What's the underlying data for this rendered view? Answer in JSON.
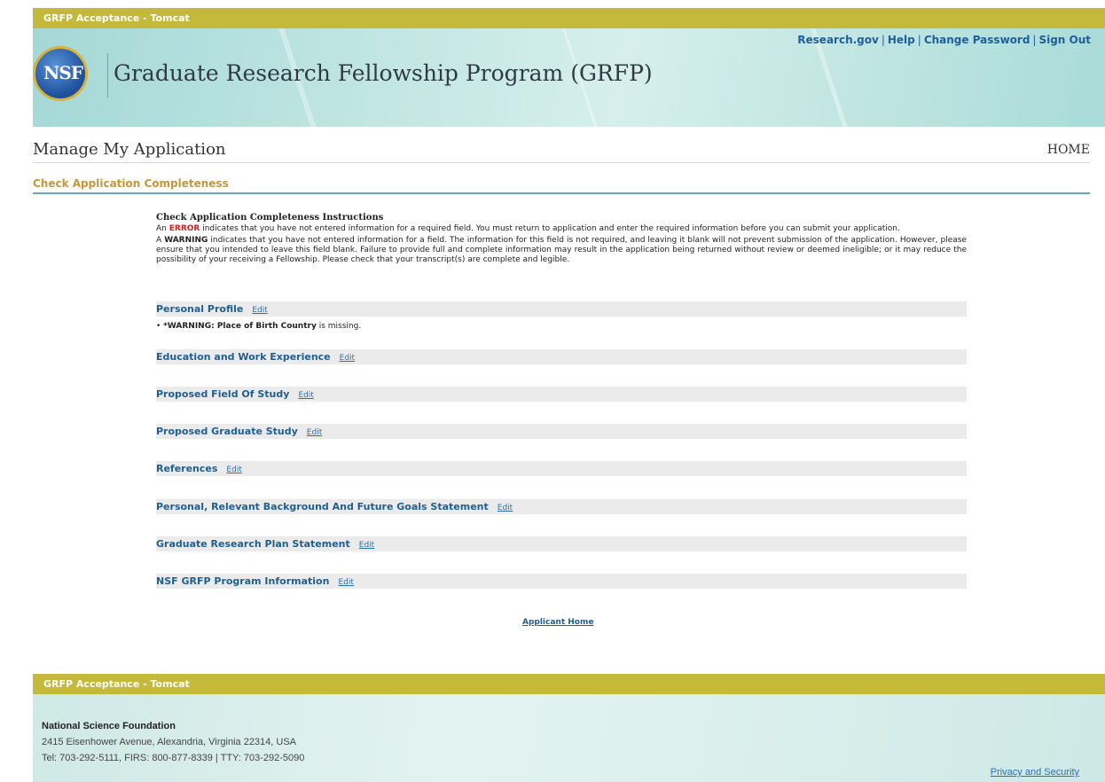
{
  "env_label": "GRFP Acceptance - Tomcat",
  "header": {
    "logo_text": "NSF",
    "title": "Graduate Research Fellowship Program (GRFP)",
    "links": [
      "Research.gov",
      "Help",
      "Change Password",
      "Sign Out"
    ]
  },
  "page": {
    "title": "Manage My Application",
    "home_link": "HOME",
    "section_title": "Check Application Completeness"
  },
  "instructions": {
    "title": "Check Application Completeness Instructions",
    "error_prefix": "An",
    "error_word": "ERROR",
    "error_text": "indicates that you have not entered information for a required field. You must return to application and enter the required information before you can submit your application.",
    "warning_prefix": "A",
    "warning_word": "WARNING",
    "warning_text": "indicates that you have not entered information for a field. The information for this field is not required, and leaving it blank will not prevent submission of the application. However, please ensure that you intended to leave this field blank. Failure to provide full and complete information may result in the application being returned without review or deemed ineligible; or it may reduce the possibility of your receiving a Fellowship. Please check that your transcript(s) are complete and legible."
  },
  "edit_label": "Edit",
  "sections": [
    {
      "label": "Personal Profile"
    },
    {
      "label": "Education and Work Experience"
    },
    {
      "label": "Proposed Field Of Study"
    },
    {
      "label": "Proposed Graduate Study"
    },
    {
      "label": "References"
    },
    {
      "label": "Personal, Relevant Background And Future Goals Statement"
    },
    {
      "label": "Graduate Research Plan Statement"
    },
    {
      "label": "NSF GRFP Program Information"
    }
  ],
  "missing_item": {
    "bold": "*WARNING: Place of Birth Country",
    "rest": "is missing."
  },
  "applicant_home": "Applicant Home",
  "footer": {
    "org": "National Science Foundation",
    "address": "2415 Eisenhower Avenue, Alexandria, Virginia 22314, USA",
    "tel": "Tel: 703-292-5111, FIRS: 800-877-8339 | TTY: 703-292-5090",
    "privacy": "Privacy and Security"
  },
  "colors": {
    "env_bar": "#c4b93a",
    "link": "#1f5f99",
    "section_title": "#c6973a",
    "error": "#d32020",
    "rule": "#5fa6c8"
  }
}
